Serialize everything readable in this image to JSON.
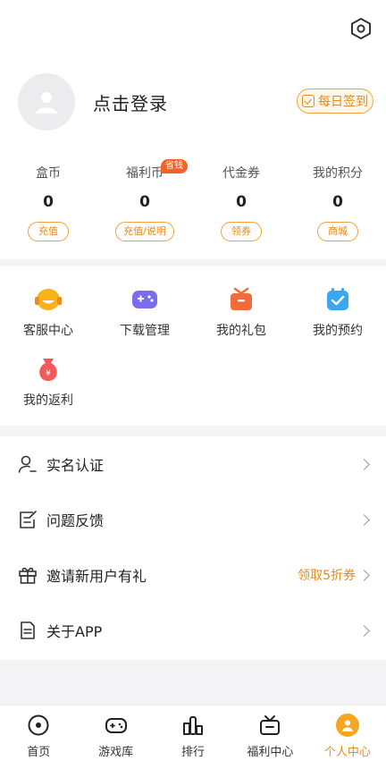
{
  "header": {
    "login_text": "点击登录",
    "checkin_label": "每日签到"
  },
  "wallet": [
    {
      "label": "盒币",
      "value": "0",
      "action": "充值"
    },
    {
      "label": "福利币",
      "value": "0",
      "action": "充值/说明",
      "badge": "省钱"
    },
    {
      "label": "代金券",
      "value": "0",
      "action": "领券"
    },
    {
      "label": "我的积分",
      "value": "0",
      "action": "商城"
    }
  ],
  "shortcuts": [
    {
      "label": "客服中心",
      "icon": "customer-service-icon"
    },
    {
      "label": "下载管理",
      "icon": "gamepad-download-icon"
    },
    {
      "label": "我的礼包",
      "icon": "gift-box-icon"
    },
    {
      "label": "我的预约",
      "icon": "calendar-check-icon"
    },
    {
      "label": "我的返利",
      "icon": "money-bag-icon"
    }
  ],
  "menu": [
    {
      "label": "实名认证",
      "icon": "user-verify-icon",
      "extra": ""
    },
    {
      "label": "问题反馈",
      "icon": "feedback-icon",
      "extra": ""
    },
    {
      "label": "邀请新用户有礼",
      "icon": "gift-icon",
      "extra": "领取5折券"
    },
    {
      "label": "关于APP",
      "icon": "document-icon",
      "extra": ""
    }
  ],
  "nav": [
    {
      "label": "首页",
      "icon": "home-icon"
    },
    {
      "label": "游戏库",
      "icon": "gamepad-icon"
    },
    {
      "label": "排行",
      "icon": "ranking-icon"
    },
    {
      "label": "福利中心",
      "icon": "gift-center-icon"
    },
    {
      "label": "个人中心",
      "icon": "profile-icon",
      "active": true
    }
  ],
  "colors": {
    "accent": "#f08a1c",
    "badge": "#f2622a",
    "background": "#f4f4f6"
  }
}
